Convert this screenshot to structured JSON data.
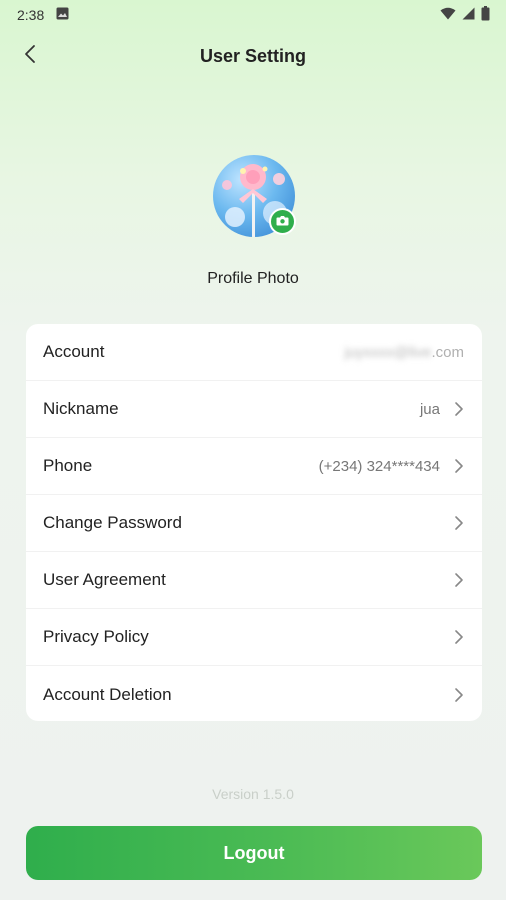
{
  "status_bar": {
    "time": "2:38"
  },
  "header": {
    "title": "User Setting"
  },
  "profile": {
    "label": "Profile Photo"
  },
  "settings": {
    "account": {
      "label": "Account",
      "value_hidden": "juyxxxx@live",
      "value_domain": ".com"
    },
    "nickname": {
      "label": "Nickname",
      "value": "jua"
    },
    "phone": {
      "label": "Phone",
      "value": "(+234) 324****434"
    },
    "change_password": {
      "label": "Change Password"
    },
    "user_agreement": {
      "label": "User Agreement"
    },
    "privacy_policy": {
      "label": "Privacy Policy"
    },
    "account_deletion": {
      "label": "Account Deletion"
    }
  },
  "footer": {
    "version": "Version 1.5.0",
    "logout_label": "Logout"
  },
  "colors": {
    "accent": "#2fae4c",
    "background_top": "#d9f6d0",
    "card": "#ffffff"
  }
}
